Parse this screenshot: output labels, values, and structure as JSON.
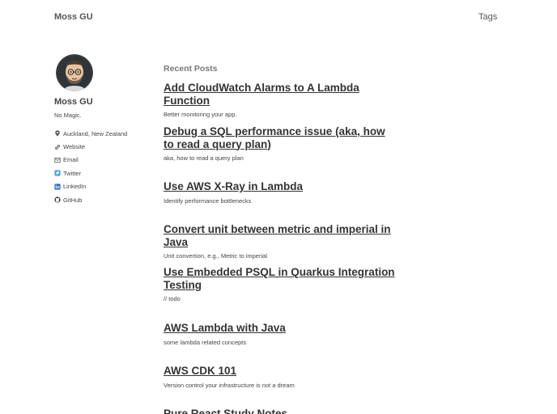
{
  "header": {
    "site_title": "Moss GU",
    "nav_tags": "Tags"
  },
  "sidebar": {
    "name": "Moss GU",
    "bio": "No Magic.",
    "links": [
      {
        "label": "Auckland, New Zealand",
        "icon": "map-pin-icon"
      },
      {
        "label": "Website",
        "icon": "link-icon"
      },
      {
        "label": "Email",
        "icon": "mail-icon"
      },
      {
        "label": "Twitter",
        "icon": "twitter-icon"
      },
      {
        "label": "LinkedIn",
        "icon": "linkedin-icon"
      },
      {
        "label": "GitHub",
        "icon": "github-icon"
      }
    ]
  },
  "main": {
    "heading": "Recent Posts",
    "posts": [
      {
        "title": "Add CloudWatch Alarms to A Lambda Function",
        "excerpt": "Better monitoring your app."
      },
      {
        "title": "Debug a SQL performance issue (aka, how to read a query plan)",
        "excerpt": "aka, how to read a query plan"
      },
      {
        "title": "Use AWS X-Ray in Lambda",
        "excerpt": "Identify performance bottlenecks"
      },
      {
        "title": "Convert unit between metric and imperial in Java",
        "excerpt": "Unit convertion, e.g., Metric to imperial"
      },
      {
        "title": "Use Embedded PSQL in Quarkus Integration Testing",
        "excerpt": "// todo"
      },
      {
        "title": "AWS Lambda with Java",
        "excerpt": "some lambda related concepts"
      },
      {
        "title": "AWS CDK 101",
        "excerpt": "Version control your infrastructure is not a dream"
      },
      {
        "title": "Pure React Study Notes",
        "excerpt": ""
      }
    ]
  }
}
